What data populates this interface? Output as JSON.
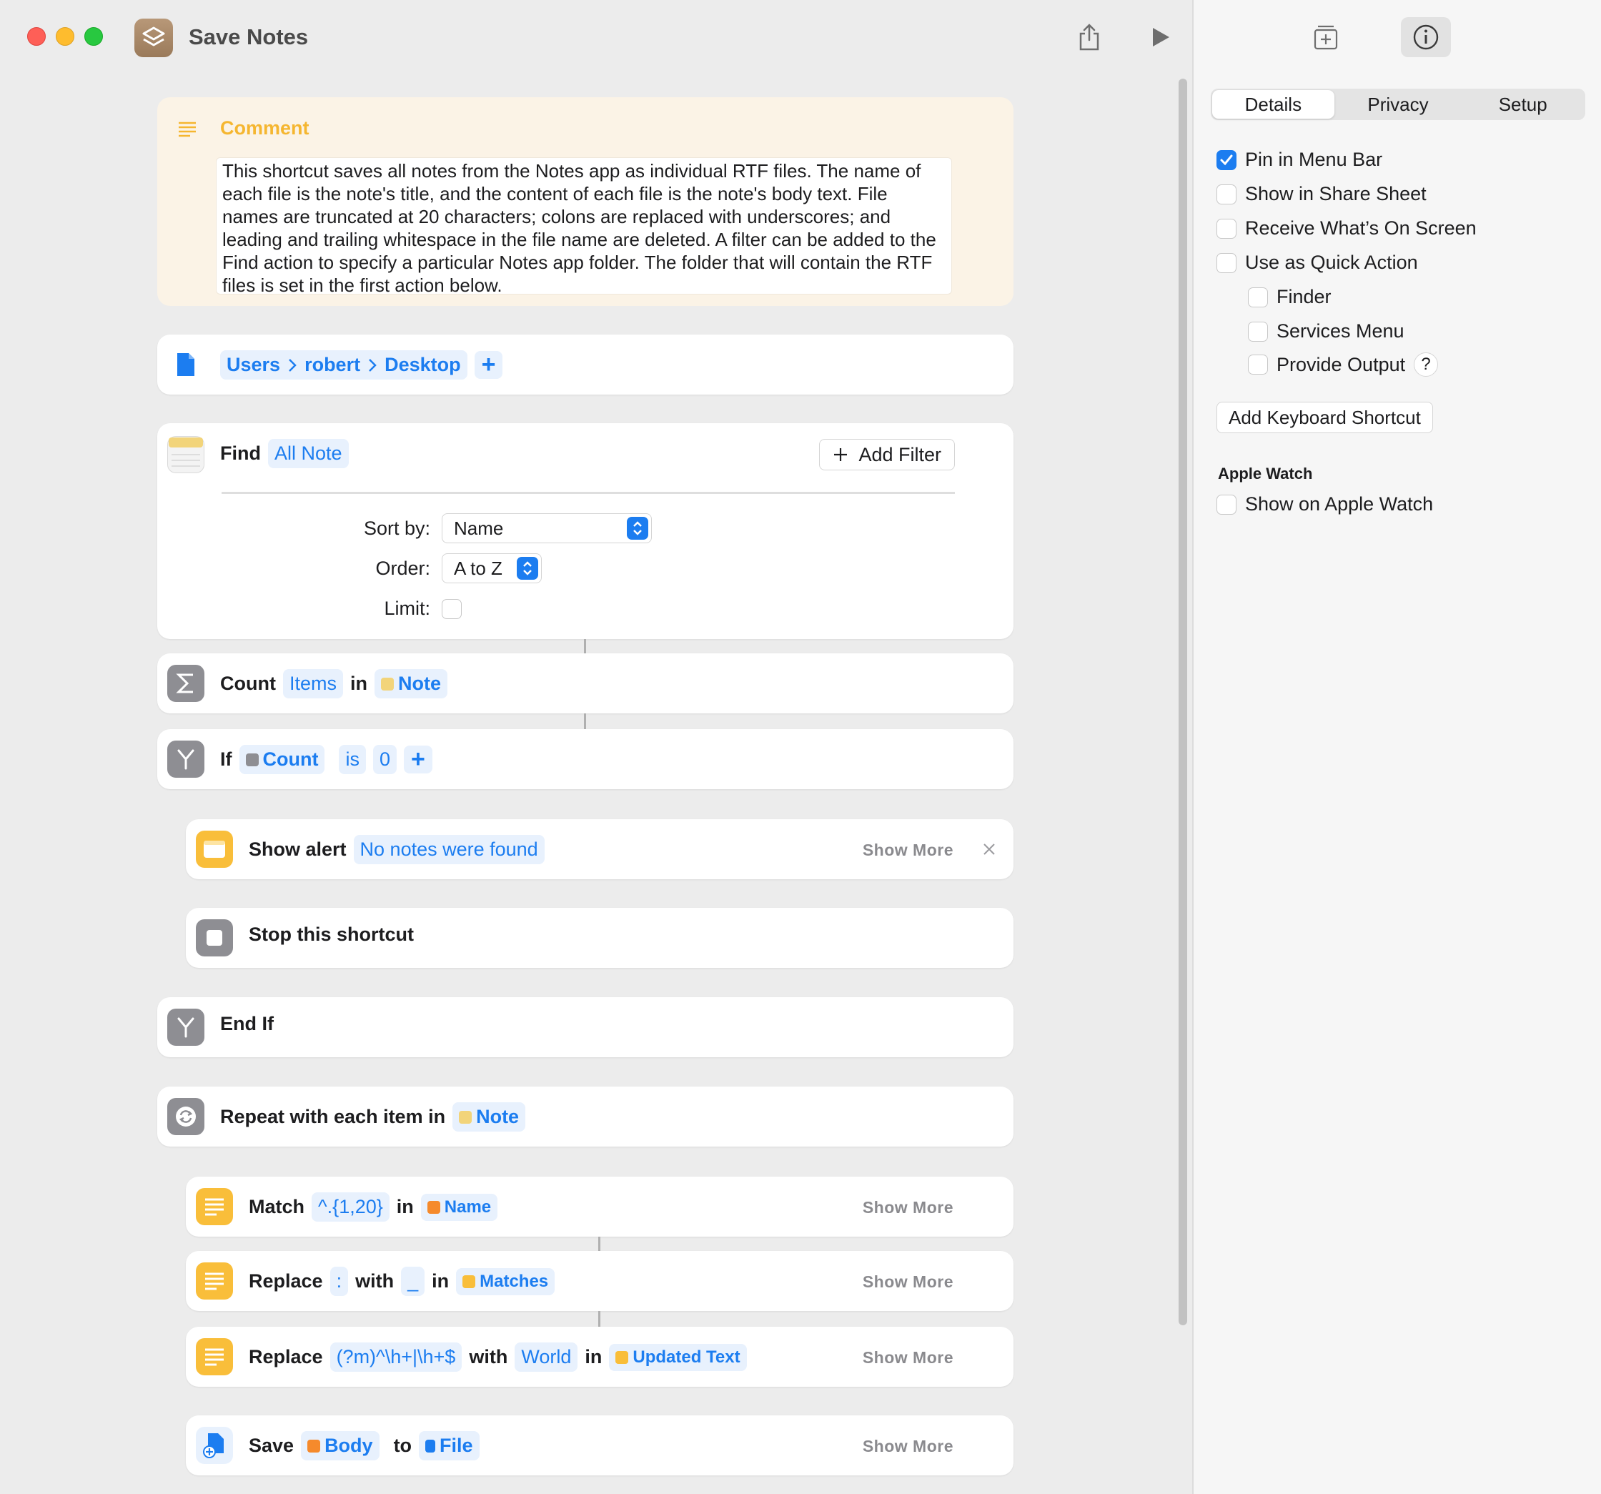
{
  "window": {
    "title": "Save Notes"
  },
  "comment": {
    "label": "Comment",
    "text": "This shortcut saves all notes from the Notes app as individual RTF files. The name of each file is the note's title, and the content of each file is the note's body text. File names are truncated at 20 characters; colons are replaced with underscores; and leading and trailing whitespace in the file name are deleted. A filter can be added to the Find action to specify a particular Notes app folder. The folder that will contain the RTF files is set in the first action below."
  },
  "folder": {
    "path": [
      "Users",
      "robert",
      "Desktop"
    ],
    "add": "+"
  },
  "find": {
    "keyword": "Find",
    "target": "All Note",
    "add_filter": "Add Filter",
    "sort_label": "Sort by:",
    "sort_value": "Name",
    "order_label": "Order:",
    "order_value": "A to Z",
    "limit_label": "Limit:"
  },
  "count": {
    "keyword": "Count",
    "items": "Items",
    "in": "in",
    "source": "Note"
  },
  "if_action": {
    "keyword": "If",
    "var": "Count",
    "op": "is",
    "value": "0",
    "add": "+"
  },
  "alert": {
    "keyword": "Show alert",
    "message": "No notes were found",
    "show_more": "Show More"
  },
  "stop": {
    "label": "Stop this shortcut"
  },
  "end_if": {
    "label": "End If"
  },
  "repeat": {
    "keyword": "Repeat with each item in",
    "source": "Note"
  },
  "match": {
    "keyword": "Match",
    "pattern": "^.{1,20}",
    "in": "in",
    "source": "Name",
    "show_more": "Show More"
  },
  "replace1": {
    "keyword": "Replace",
    "find": ":",
    "with": "with",
    "replacement": "_",
    "in": "in",
    "source": "Matches",
    "show_more": "Show More"
  },
  "replace2": {
    "keyword": "Replace",
    "find": "(?m)^\\h+|\\h+$",
    "with": "with",
    "replacement": "World",
    "in": "in",
    "source": "Updated Text",
    "show_more": "Show More"
  },
  "save": {
    "keyword": "Save",
    "var": "Body",
    "to": "to",
    "dest": "File",
    "show_more": "Show More"
  },
  "inspector": {
    "tabs": [
      "Details",
      "Privacy",
      "Setup"
    ],
    "options": {
      "pin_menu_bar": "Pin in Menu Bar",
      "share_sheet": "Show in Share Sheet",
      "on_screen": "Receive What’s On Screen",
      "quick_action": "Use as Quick Action",
      "finder": "Finder",
      "services": "Services Menu",
      "provide_output": "Provide Output",
      "help": "?"
    },
    "keyboard_button": "Add Keyboard Shortcut",
    "watch_section": "Apple Watch",
    "watch_option": "Show on Apple Watch"
  },
  "colors": {
    "accent": "#1c7df0",
    "comment_bg": "#fbf3e6",
    "comment_label": "#f5b630",
    "text_icon": "#f9be3a",
    "notes_icon": "#f2d47a"
  }
}
